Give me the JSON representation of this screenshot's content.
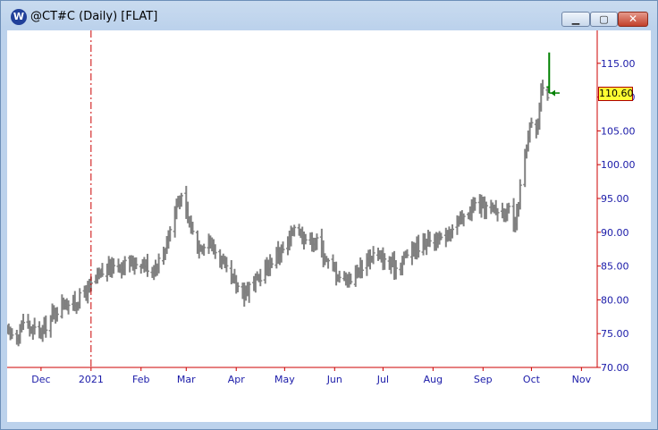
{
  "window": {
    "title": "@CT#C (Daily) [FLAT]",
    "app_icon": "W",
    "controls": {
      "minimize_icon": "minimize-icon",
      "maximize_icon": "maximize-icon",
      "close_icon": "close-icon"
    }
  },
  "price_label": "110.60",
  "colors": {
    "bars": "#808080",
    "latest_bar": "#008000",
    "axis": "#cc0000",
    "tick_text": "#1a1aa8",
    "price_box": "#ffff33"
  },
  "chart_data": {
    "type": "ohlc",
    "symbol": "@CT#C",
    "interval": "Daily",
    "x_range": [
      "2020-11-10",
      "2021-11-08"
    ],
    "ylim": [
      70,
      120
    ],
    "y_ticks": [
      "115.00",
      "110.00",
      "105.00",
      "100.00",
      "95.00",
      "90.00",
      "85.00",
      "80.00",
      "75.00",
      "70.00"
    ],
    "x_ticks": [
      {
        "label": "Dec",
        "date": "2020-12-01"
      },
      {
        "label": "2021",
        "date": "2021-01-01"
      },
      {
        "label": "Feb",
        "date": "2021-02-01"
      },
      {
        "label": "Mar",
        "date": "2021-03-01"
      },
      {
        "label": "Apr",
        "date": "2021-04-01"
      },
      {
        "label": "May",
        "date": "2021-05-01"
      },
      {
        "label": "Jun",
        "date": "2021-06-01"
      },
      {
        "label": "Jul",
        "date": "2021-07-01"
      },
      {
        "label": "Aug",
        "date": "2021-08-01"
      },
      {
        "label": "Sep",
        "date": "2021-09-01"
      },
      {
        "label": "Oct",
        "date": "2021-10-01"
      },
      {
        "label": "Nov",
        "date": "2021-11-01"
      }
    ],
    "year_divider": "2021-01-01",
    "last_price": 110.6,
    "close_path": [
      [
        "2020-11-10",
        75.3
      ],
      [
        "2020-11-16",
        74.6
      ],
      [
        "2020-11-20",
        76.8
      ],
      [
        "2020-11-25",
        75.6
      ],
      [
        "2020-12-01",
        75.2
      ],
      [
        "2020-12-07",
        77.3
      ],
      [
        "2020-12-14",
        79.6
      ],
      [
        "2020-12-21",
        79.3
      ],
      [
        "2020-12-28",
        81.0
      ],
      [
        "2021-01-04",
        82.9
      ],
      [
        "2021-01-11",
        84.7
      ],
      [
        "2021-01-18",
        85.2
      ],
      [
        "2021-01-25",
        85.3
      ],
      [
        "2021-02-01",
        85.6
      ],
      [
        "2021-02-08",
        84.4
      ],
      [
        "2021-02-15",
        86.9
      ],
      [
        "2021-02-19",
        90.5
      ],
      [
        "2021-02-25",
        95.5
      ],
      [
        "2021-03-01",
        92.5
      ],
      [
        "2021-03-08",
        88.0
      ],
      [
        "2021-03-15",
        88.8
      ],
      [
        "2021-03-22",
        86.0
      ],
      [
        "2021-03-29",
        83.0
      ],
      [
        "2021-04-05",
        81.2
      ],
      [
        "2021-04-12",
        82.3
      ],
      [
        "2021-04-19",
        84.5
      ],
      [
        "2021-04-26",
        86.8
      ],
      [
        "2021-05-03",
        87.9
      ],
      [
        "2021-05-07",
        91.2
      ],
      [
        "2021-05-14",
        89.1
      ],
      [
        "2021-05-21",
        88.6
      ],
      [
        "2021-05-28",
        85.4
      ],
      [
        "2021-06-04",
        83.5
      ],
      [
        "2021-06-11",
        83.2
      ],
      [
        "2021-06-18",
        85.1
      ],
      [
        "2021-06-25",
        86.8
      ],
      [
        "2021-07-02",
        85.6
      ],
      [
        "2021-07-09",
        84.8
      ],
      [
        "2021-07-16",
        86.9
      ],
      [
        "2021-07-23",
        88.0
      ],
      [
        "2021-07-30",
        89.2
      ],
      [
        "2021-08-06",
        88.6
      ],
      [
        "2021-08-13",
        90.9
      ],
      [
        "2021-08-20",
        92.0
      ],
      [
        "2021-08-27",
        94.1
      ],
      [
        "2021-09-03",
        93.6
      ],
      [
        "2021-09-10",
        93.2
      ],
      [
        "2021-09-17",
        93.1
      ],
      [
        "2021-09-20",
        90.0
      ],
      [
        "2021-09-22",
        92.3
      ],
      [
        "2021-09-25",
        98.5
      ],
      [
        "2021-09-29",
        103.5
      ],
      [
        "2021-10-01",
        106.5
      ],
      [
        "2021-10-04",
        104.6
      ],
      [
        "2021-10-06",
        108.6
      ],
      [
        "2021-10-08",
        112.0
      ],
      [
        "2021-10-11",
        110.6
      ]
    ],
    "latest_bar": {
      "date": "2021-10-12",
      "high": 116.6,
      "low": 110.6,
      "open": 111.5,
      "close": 110.6,
      "color": "#008000"
    }
  }
}
